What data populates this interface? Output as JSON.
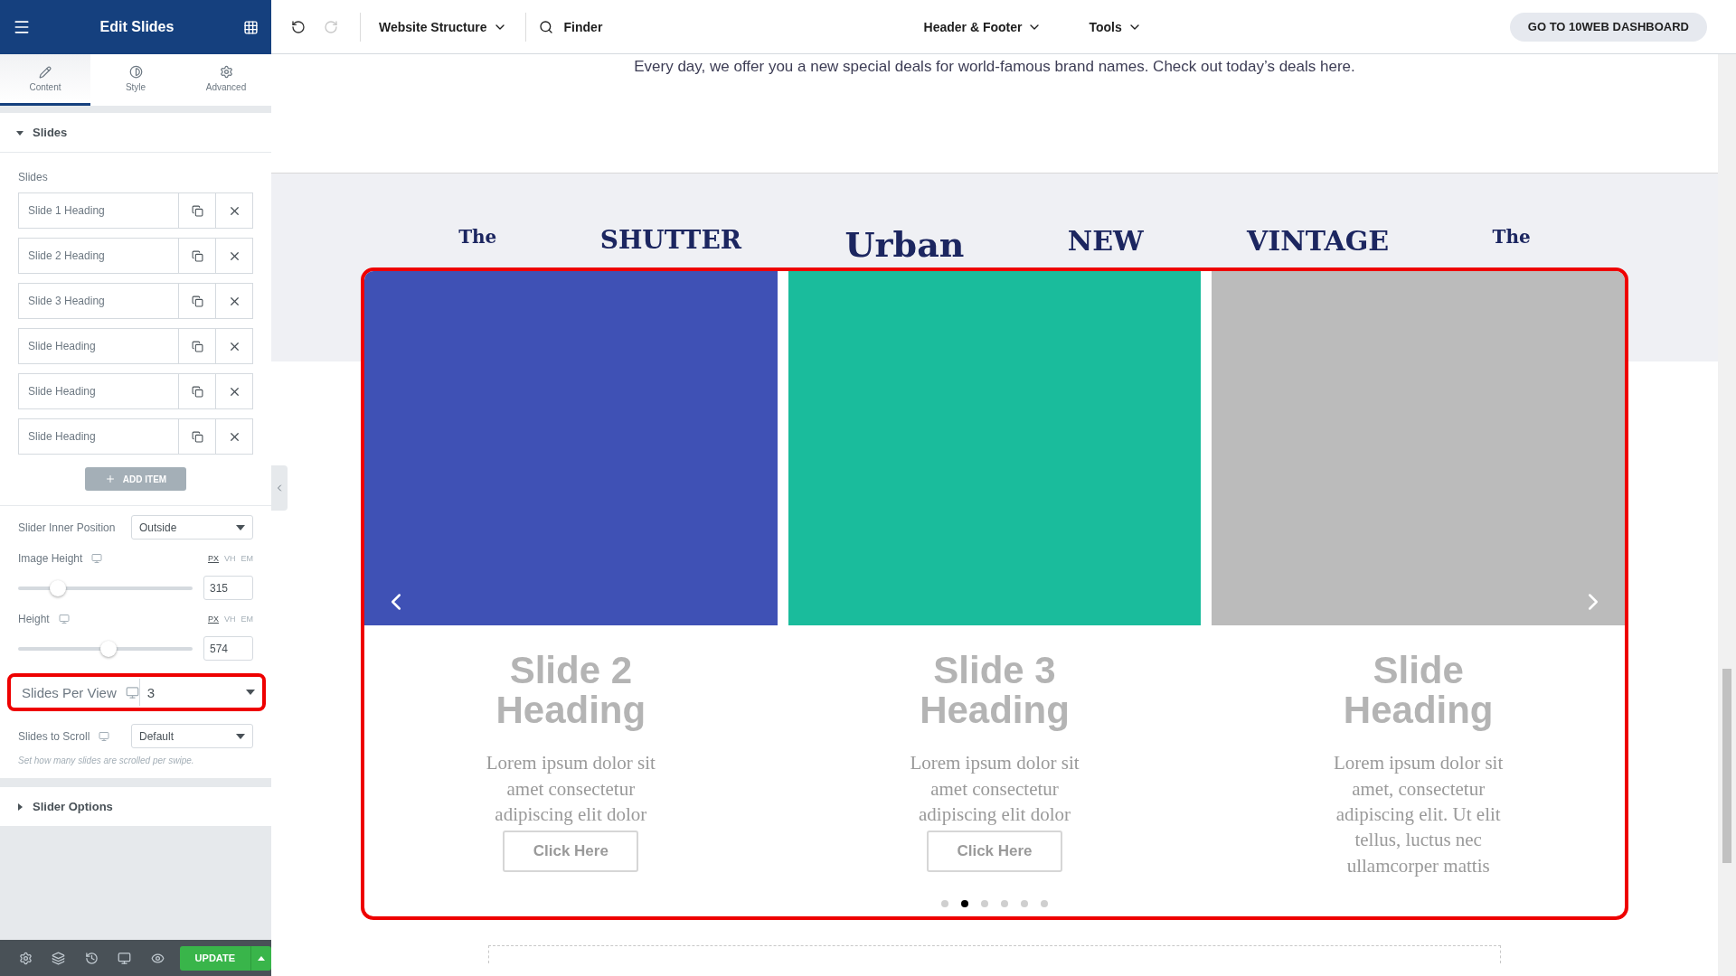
{
  "sidebar": {
    "title": "Edit Slides",
    "tabs": [
      {
        "kind": "content",
        "label": "Content",
        "selected": true
      },
      {
        "kind": "style",
        "label": "Style",
        "selected": false
      },
      {
        "kind": "advanced",
        "label": "Advanced",
        "selected": false
      }
    ],
    "section": {
      "title": "Slides",
      "expanded": true
    },
    "repeater_label": "Slides",
    "items": [
      "Slide 1 Heading",
      "Slide 2 Heading",
      "Slide 3 Heading",
      "Slide Heading",
      "Slide Heading",
      "Slide Heading"
    ],
    "add_button": "ADD ITEM",
    "controls": [
      {
        "kind": "select",
        "label": "Slider Inner Position",
        "value": "Outside",
        "responsive": false,
        "highlighted": false
      },
      {
        "kind": "slider",
        "label": "Image Height",
        "responsive": true,
        "units": [
          {
            "label": "PX",
            "selected": true
          },
          {
            "label": "VH",
            "selected": false
          },
          {
            "label": "EM",
            "selected": false
          }
        ],
        "level": 0.23,
        "value": "315"
      },
      {
        "kind": "slider",
        "label": "Height",
        "responsive": true,
        "units": [
          {
            "label": "PX",
            "selected": true
          },
          {
            "label": "VH",
            "selected": false
          },
          {
            "label": "EM",
            "selected": false
          }
        ],
        "level": 0.52,
        "value": "574"
      },
      {
        "kind": "select",
        "label": "Slides Per View",
        "value": "3",
        "responsive": true,
        "highlighted": true
      },
      {
        "kind": "select",
        "label": "Slides to Scroll",
        "value": "Default",
        "responsive": true,
        "highlighted": false,
        "help": "Set how many slides are scrolled per swipe."
      }
    ],
    "collapsed_section": {
      "title": "Slider Options",
      "expanded": false
    },
    "update_button": "UPDATE"
  },
  "topbar": {
    "menu": "Website Structure",
    "search": "Finder",
    "center_menus": [
      "Header & Footer",
      "Tools"
    ],
    "dashboard_button": "GO TO 10WEB DASHBOARD"
  },
  "page": {
    "intro": "Every day, we offer you a new special deals for world-famous brand names. Check out today’s deals here.",
    "logos": [
      "The",
      "SHUTTER",
      "Urban",
      "NEW",
      "VINTAGE",
      "The"
    ],
    "slides": [
      {
        "color": "#3f51b5",
        "heading": "Slide 2 Heading",
        "text": "Lorem ipsum dolor sit amet consectetur adipiscing elit dolor",
        "button": "Click Here"
      },
      {
        "color": "#1abc9c",
        "heading": "Slide 3 Heading",
        "text": "Lorem ipsum dolor sit amet consectetur adipiscing elit dolor",
        "button": "Click Here"
      },
      {
        "color": "#bbbbbb",
        "heading": "Slide Heading",
        "text": "Lorem ipsum dolor sit amet, consectetur adipiscing elit. Ut elit tellus, luctus nec ullamcorper mattis"
      }
    ],
    "dots": [
      {
        "selected": false
      },
      {
        "selected": true
      },
      {
        "selected": false
      },
      {
        "selected": false
      },
      {
        "selected": false
      },
      {
        "selected": false
      }
    ]
  }
}
